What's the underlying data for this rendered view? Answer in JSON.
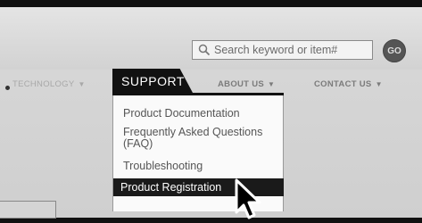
{
  "search": {
    "placeholder": "Search keyword or item#",
    "go_label": "GO"
  },
  "nav": {
    "items": [
      {
        "label": "TECHNOLOGY",
        "caret": "▼"
      },
      {
        "label": "SUPPORT"
      },
      {
        "label": "ABOUT US",
        "caret": "▼"
      },
      {
        "label": "CONTACT US",
        "caret": "▼"
      }
    ]
  },
  "dropdown": {
    "items": [
      {
        "label": "Product Documentation"
      },
      {
        "label": "Frequently Asked Questions",
        "label_line2": "(FAQ)"
      },
      {
        "label": "Troubleshooting"
      },
      {
        "label": "Product Registration",
        "state": "hovered"
      }
    ]
  },
  "colors": {
    "active_tab_bg": "#111111",
    "highlight_bg": "#1a1a1a",
    "nav_text": "#7b7b7b"
  }
}
